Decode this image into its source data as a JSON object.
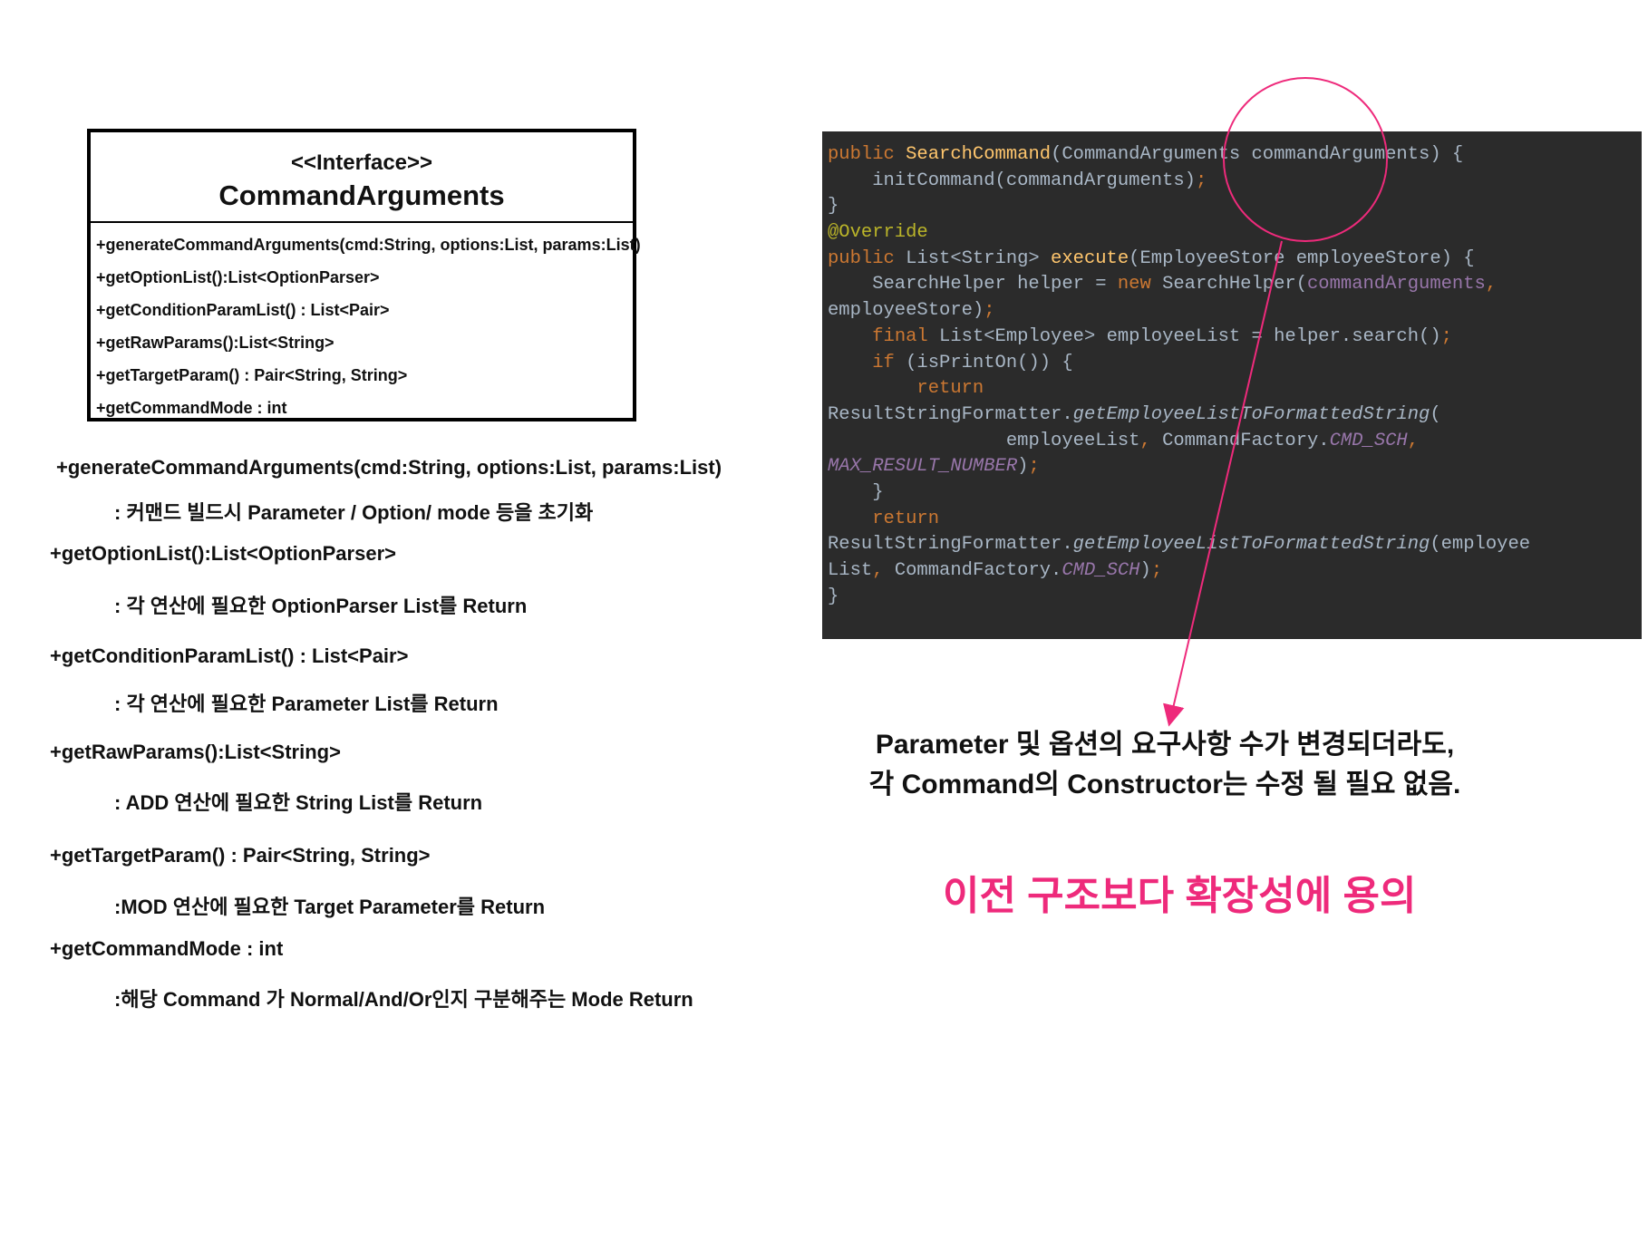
{
  "uml": {
    "stereotype": "<<Interface>>",
    "name": "CommandArguments",
    "methods": [
      "+generateCommandArguments(cmd:String, options:List, params:List)",
      "+getOptionList():List<OptionParser>",
      "+getConditionParamList() : List<Pair>",
      "+getRawParams():List<String>",
      "+getTargetParam() : Pair<String, String>",
      "+getCommandMode : int"
    ]
  },
  "descriptions": [
    {
      "signature": "+generateCommandArguments(cmd:String, options:List, params:List)",
      "note": ": 커맨드 빌드시 Parameter / Option/ mode 등을 초기화"
    },
    {
      "signature": "+getOptionList():List<OptionParser>",
      "note": ": 각 연산에 필요한 OptionParser List를 Return"
    },
    {
      "signature": "+getConditionParamList() : List<Pair>",
      "note": ": 각 연산에 필요한 Parameter List를 Return"
    },
    {
      "signature": "+getRawParams():List<String>",
      "note": ": ADD 연산에 필요한 String List를 Return"
    },
    {
      "signature": "+getTargetParam() : Pair<String, String>",
      "note": ":MOD 연산에 필요한 Target Parameter를 Return"
    },
    {
      "signature": "+getCommandMode : int",
      "note": ":해당 Command 가 Normal/And/Or인지 구분해주는 Mode Return"
    }
  ],
  "code": {
    "t": {
      "public": "public",
      "ctor": "SearchCommand",
      "ctor_args": "(CommandArguments commandArguments) {",
      "init_call": "    initCommand(commandArguments)",
      "semicolon": ";",
      "close": "}",
      "override": "@Override",
      "ret_type": " List<String> ",
      "exec": "execute",
      "exec_args": "(EmployeeStore employeeStore) {",
      "helper_decl": "    SearchHelper helper = ",
      "new": "new",
      "helper_ctor": " SearchHelper(",
      "cmd_args_field": "commandArguments",
      "comma": ",",
      "emp_store": "employeeStore)",
      "indent4": "    ",
      "final": "final",
      "list_decl": " List<Employee> employeeList = helper.search()",
      "if": "if",
      "if_cond": " (isPrintOn()) {",
      "indent8": "        ",
      "return": "return",
      "formatter": "ResultStringFormatter.",
      "format_fn": "getEmployeeListToFormattedString",
      "open_paren": "(",
      "indent24": "                ",
      "emp_list": "employeeList",
      "factory": " CommandFactory.",
      "cmd_sch": "CMD_SCH",
      "max_result": "MAX_RESULT_NUMBER",
      "close_paren": ")",
      "close_brace_in": "    }",
      "emp_tail": "(employee",
      "list_word": "List",
      "close_paren_semi": ")"
    }
  },
  "conclusion": {
    "line1": "Parameter 및 옵션의 요구사항 수가 변경되더라도,",
    "line2": "각 Command의 Constructor는 수정 될 필요 없음."
  },
  "highlight": "이전 구조보다 확장성에 용의",
  "colors": {
    "accent": "#ee2a7b",
    "code_bg": "#2b2b2b",
    "keyword": "#cc7832",
    "function": "#ffc66d",
    "annotation": "#bbb529",
    "field": "#9876aa",
    "plain": "#a9b7c6"
  }
}
